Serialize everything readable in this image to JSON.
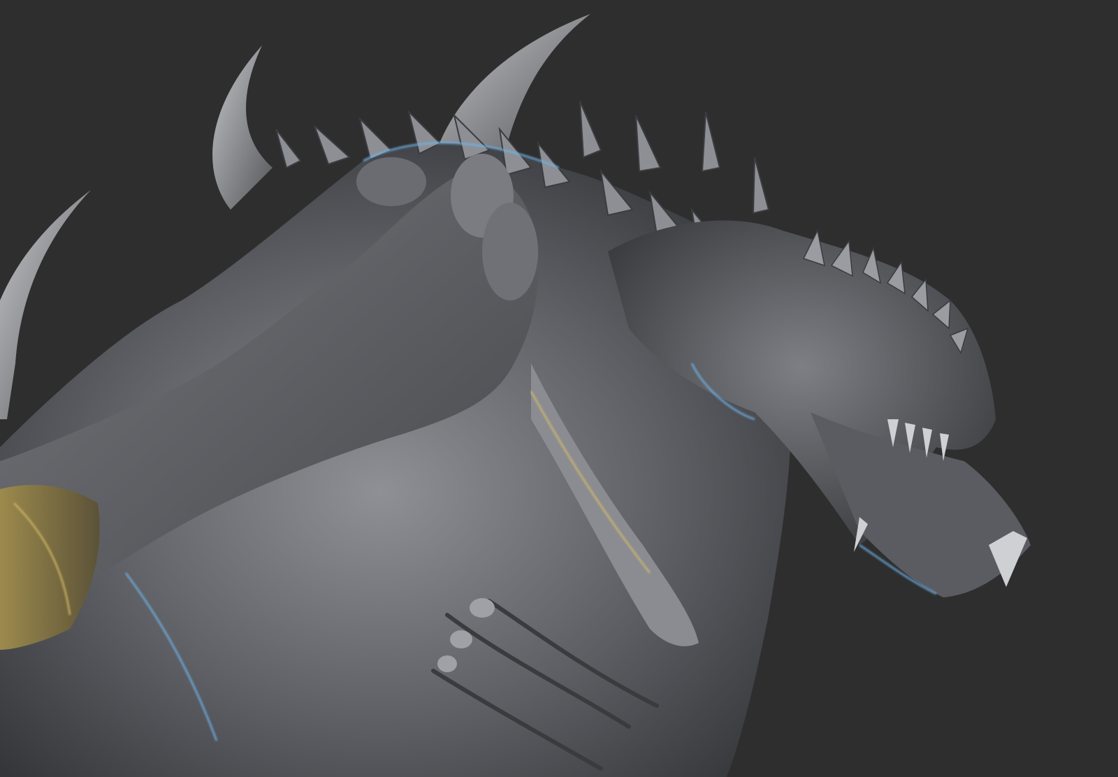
{
  "scene": {
    "subject": "",
    "background_color": "#2e2e2e",
    "colors": {
      "clay_dark": "#3a3b3e",
      "clay_mid": "#6d6f74",
      "clay_light": "#a9abb0",
      "rim_blue": "#6fb4ea",
      "rim_gold": "#d8bc6a",
      "horn_light": "#b7b8bc"
    }
  }
}
